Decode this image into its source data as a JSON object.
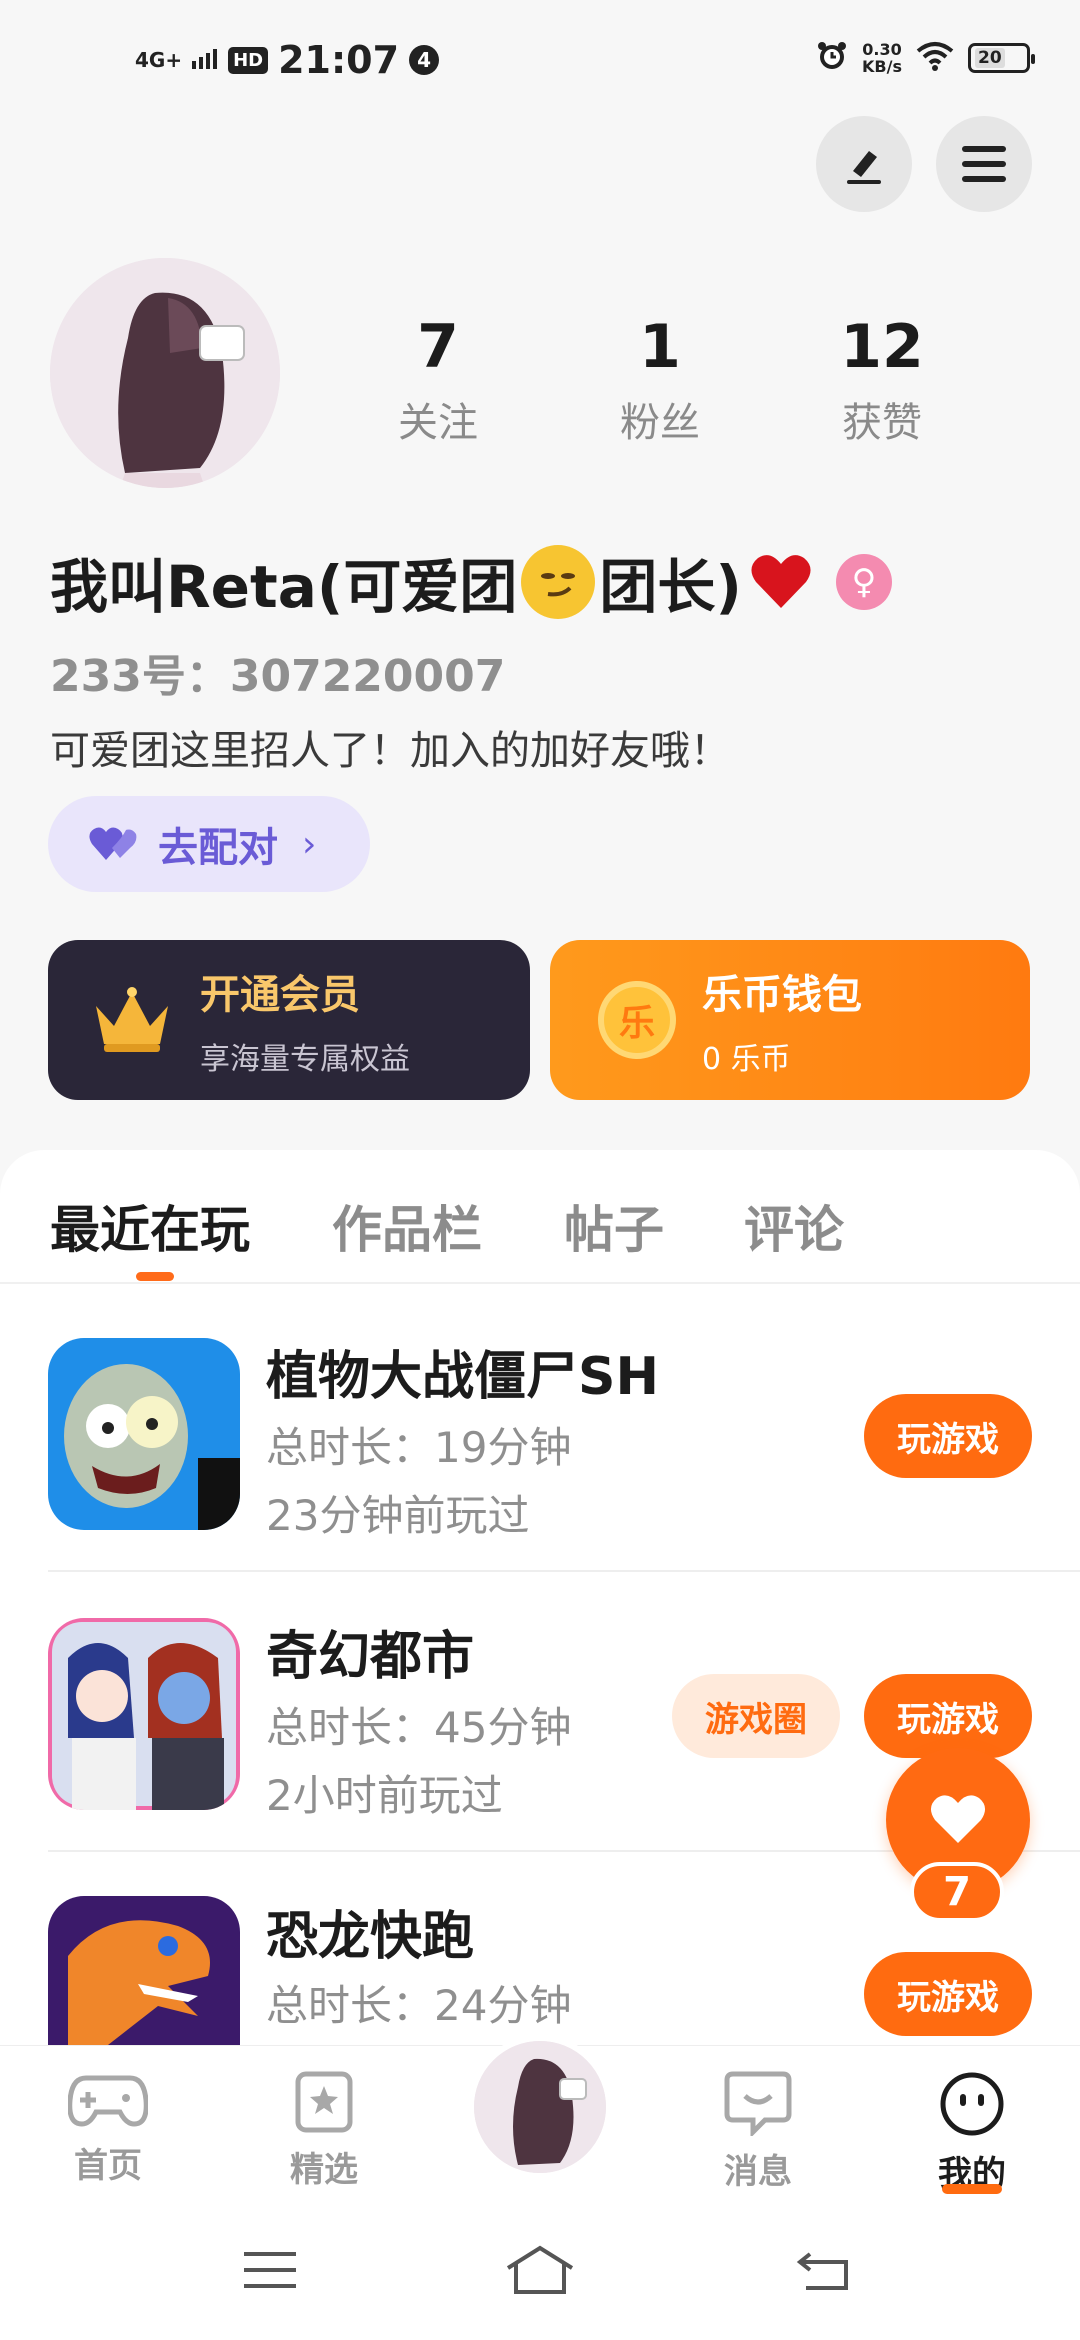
{
  "status_bar": {
    "network": "4G+",
    "hd": "HD",
    "time": "21:07",
    "notification_count": "4",
    "net_speed_value": "0.30",
    "net_speed_unit": "KB/s",
    "battery": "20"
  },
  "profile": {
    "stats": [
      {
        "value": "7",
        "label": "关注"
      },
      {
        "value": "1",
        "label": "粉丝"
      },
      {
        "value": "12",
        "label": "获赞"
      }
    ],
    "nickname_part1": "我叫Reta(可爱团",
    "nickname_part2": "团长)",
    "uid": "233号：307220007",
    "bio": "可爱团这里招人了！加入的加好友哦！",
    "match_label": "去配对"
  },
  "cards": {
    "vip_title": "开通会员",
    "vip_sub": "享海量专属权益",
    "wallet_title": "乐币钱包",
    "wallet_sub": "0 乐币",
    "coin_char": "乐"
  },
  "tabs": [
    "最近在玩",
    "作品栏",
    "帖子",
    "评论"
  ],
  "games": [
    {
      "name": "植物大战僵尸SH",
      "duration": "总时长：19分钟",
      "last_played": "23分钟前玩过",
      "play": "玩游戏"
    },
    {
      "name": "奇幻都市",
      "duration": "总时长：45分钟",
      "last_played": "2小时前玩过",
      "play": "玩游戏",
      "circle": "游戏圈"
    },
    {
      "name": "恐龙快跑",
      "duration": "总时长：24分钟",
      "play": "玩游戏"
    }
  ],
  "like_count": "7",
  "bottom_nav": [
    "首页",
    "精选",
    "消息",
    "我的"
  ],
  "colors": {
    "accent": "#ff6b10",
    "vip_card": "#2a2638",
    "match_bg": "#e9e5fb"
  }
}
